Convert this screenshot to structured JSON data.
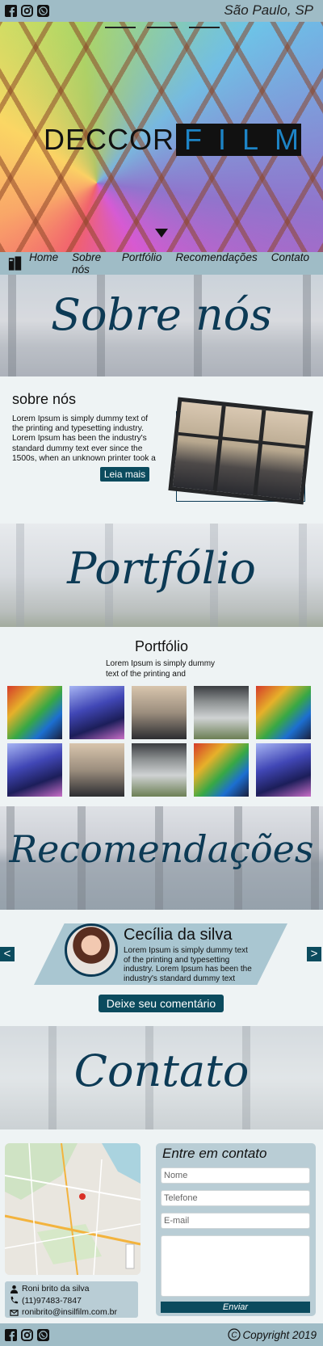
{
  "header": {
    "city": "São Paulo, SP",
    "social": [
      "facebook-icon",
      "instagram-icon",
      "whatsapp-icon"
    ]
  },
  "hero": {
    "logo_part1": "DECCOR",
    "logo_part2": "FILM"
  },
  "nav": {
    "items": [
      "Home",
      "Sobre nós",
      "Portfólio",
      "Recomendações",
      "Contato"
    ]
  },
  "banners": {
    "sobre": "Sobre nós",
    "portfolio": "Portfólio",
    "recomendacoes": "Recomendações",
    "contato": "Contato"
  },
  "sobre": {
    "heading": "sobre nós",
    "text": "Lorem Ipsum is simply dummy text of the printing and typesetting industry. Lorem Ipsum has been the industry's standard dummy text ever since the 1500s, when an unknown printer took a",
    "button": "Leia mais"
  },
  "portfolio": {
    "heading": "Portfólio",
    "text": "Lorem Ipsum is simply dummy text of the printing and",
    "tiles": [
      "graffiti",
      "building",
      "window",
      "office",
      "graffiti",
      "building",
      "window",
      "office",
      "graffiti",
      "building"
    ]
  },
  "recomendacoes": {
    "prev": "<",
    "next": ">",
    "name": "Cecília da silva",
    "text": "Lorem Ipsum is simply dummy text of the printing and typesetting industry. Lorem Ipsum has been the industry's standard dummy text",
    "button": "Deixe seu comentário"
  },
  "contato": {
    "info": {
      "name": "Roni brito da silva",
      "phone": "(11)97483-7847",
      "email": "ronibrito@insilfilm.com.br"
    },
    "form": {
      "title": "Entre em contato",
      "nome": "Nome",
      "telefone": "Telefone",
      "email": "E-mail",
      "send": "Enviar"
    }
  },
  "footer": {
    "copyright": "Copyright 2019",
    "copyright_symbol": "C"
  },
  "colors": {
    "bar": "#9fbcc6",
    "accent": "#0b4b5e",
    "title": "#0c3a55",
    "panel": "#b9cdd5"
  }
}
